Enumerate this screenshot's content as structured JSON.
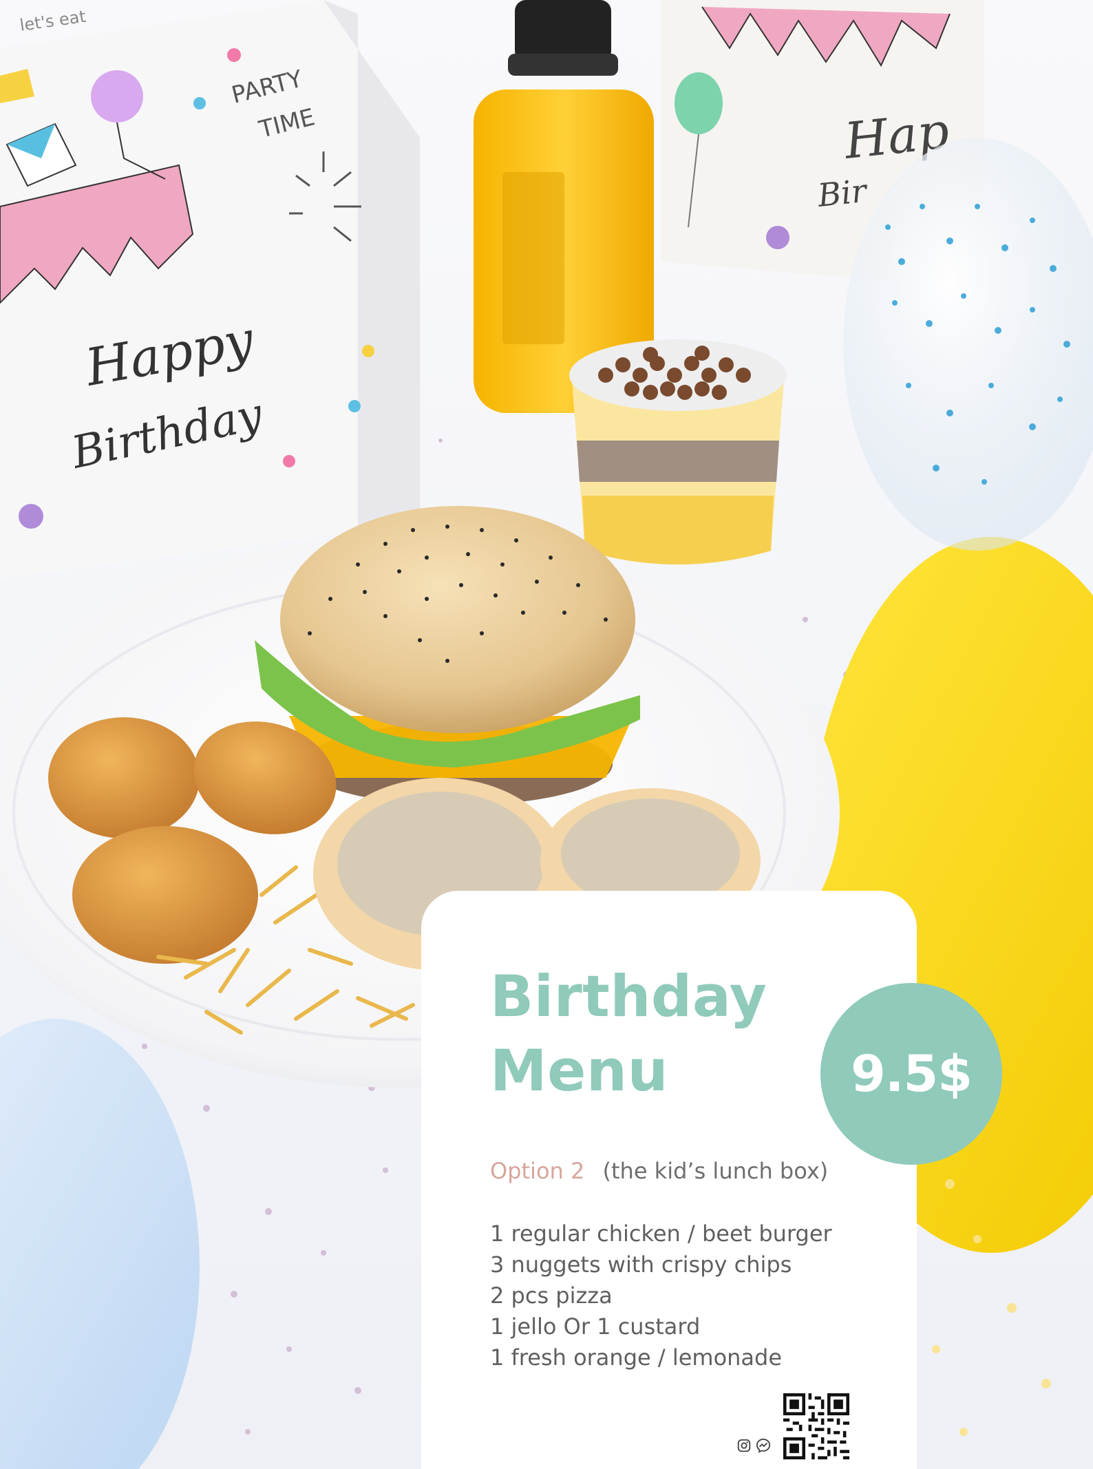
{
  "menu": {
    "title_line1": "Birthday",
    "title_line2": "Menu",
    "price": "9.5$",
    "option_label": "Option 2",
    "option_note": "(the kid’s lunch box)",
    "items": [
      "1 regular chicken / beet burger",
      "3 nuggets with crispy chips",
      "2 pcs pizza",
      "1 jello Or 1 custard",
      "1 fresh orange / lemonade"
    ]
  },
  "photo": {
    "box_left_text": {
      "top": "let's eat",
      "party": "PARTY",
      "time": "TIME",
      "happy": "Happy",
      "birthday": "Birthday"
    },
    "box_right_text": {
      "happy": "Hap",
      "birthday": "Bir"
    }
  },
  "icons": {
    "social": [
      "instagram-icon",
      "messenger-icon"
    ],
    "qr": "qr-code-icon"
  },
  "colors": {
    "accent": "#8fcabb",
    "option": "#d7a59a",
    "text": "#5f5f5f",
    "yellow": "#f6d90b"
  }
}
